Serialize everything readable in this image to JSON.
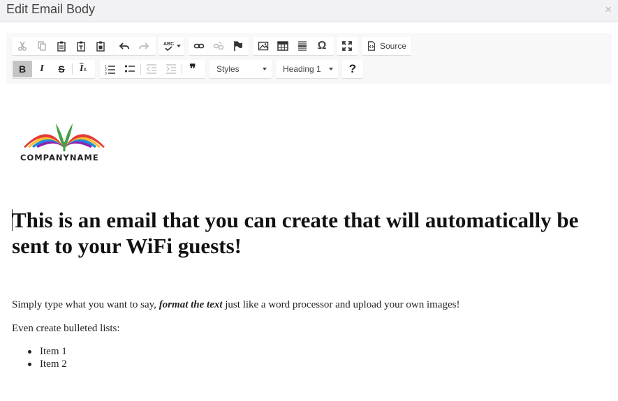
{
  "dialog": {
    "title": "Edit Email Body",
    "close_symbol": "×"
  },
  "toolbar": {
    "row1": [
      "cut-icon",
      "copy-icon",
      "paste-icon",
      "paste-text-icon",
      "paste-word-icon",
      "undo-icon",
      "redo-icon",
      "spellcheck-icon",
      "link-icon",
      "unlink-icon",
      "anchor-icon",
      "image-icon",
      "table-icon",
      "horizontal-rule-icon",
      "special-char-icon",
      "maximize-icon",
      "source-icon"
    ],
    "spell_label": "ABC",
    "omega_symbol": "Ω",
    "source_label": "Source",
    "row2": [
      "bold-icon",
      "italic-icon",
      "strike-icon",
      "remove-format-icon",
      "numbered-list-icon",
      "bulleted-list-icon",
      "outdent-icon",
      "indent-icon",
      "blockquote-icon"
    ],
    "bold_label": "B",
    "italic_label": "I",
    "strike_label": "S",
    "clear_label": "I",
    "clear_sub": "x",
    "quote_symbol": "❞",
    "styles_label": "Styles",
    "format_label": "Heading 1",
    "help_label": "?"
  },
  "content": {
    "logo_text": "COMPANYNAME",
    "heading": "This is an email that you can create that will automatically be sent to your WiFi guests!",
    "para1_a": "Simply type what you want to say, ",
    "para1_em": "format the text",
    "para1_b": " just like a word processor and upload your own images!",
    "para2": "Even create bulleted lists:",
    "list_items": [
      "Item 1",
      "Item 2"
    ]
  },
  "colors": {
    "logo_arcs": [
      "#e53935",
      "#fbc02d",
      "#1e88e5",
      "#8e24aa",
      "#43a047"
    ],
    "accent_active": "#c4c4c4"
  }
}
